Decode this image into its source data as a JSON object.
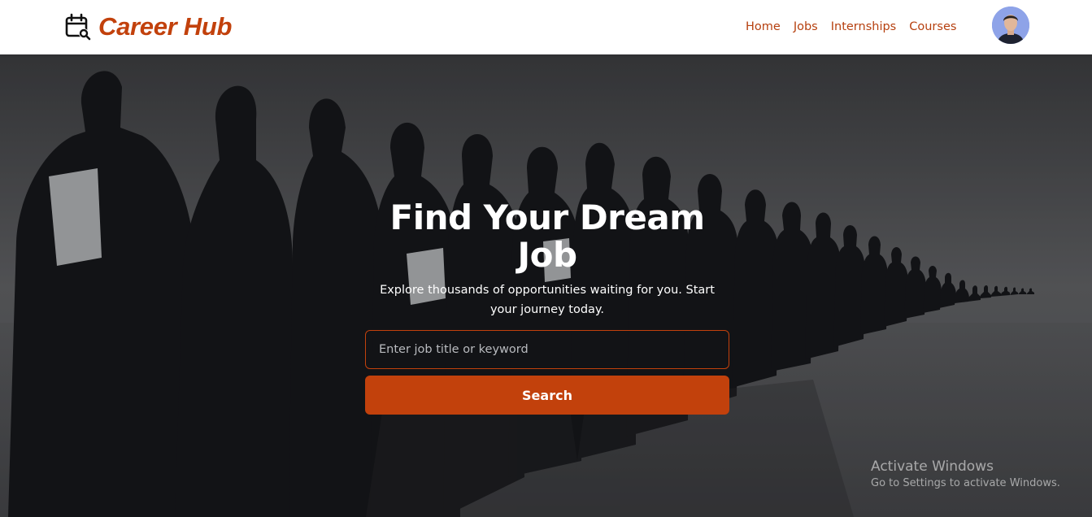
{
  "brand": {
    "name": "Career Hub",
    "icon": "calendar-search-icon",
    "color": "#c2410c"
  },
  "nav": {
    "items": [
      "Home",
      "Jobs",
      "Internships",
      "Courses"
    ]
  },
  "user": {
    "avatar": "user-avatar"
  },
  "hero": {
    "title": "Find Your Dream Job",
    "subtitle": "Explore thousands of opportunities waiting for you. Start your journey today.",
    "search_placeholder": "Enter job title or keyword",
    "search_value": "",
    "search_button": "Search"
  },
  "watermark": {
    "title": "Activate Windows",
    "subtitle": "Go to Settings to activate Windows."
  },
  "colors": {
    "accent": "#c2410c",
    "navbar_bg": "#ffffff",
    "hero_text": "#ffffff"
  }
}
